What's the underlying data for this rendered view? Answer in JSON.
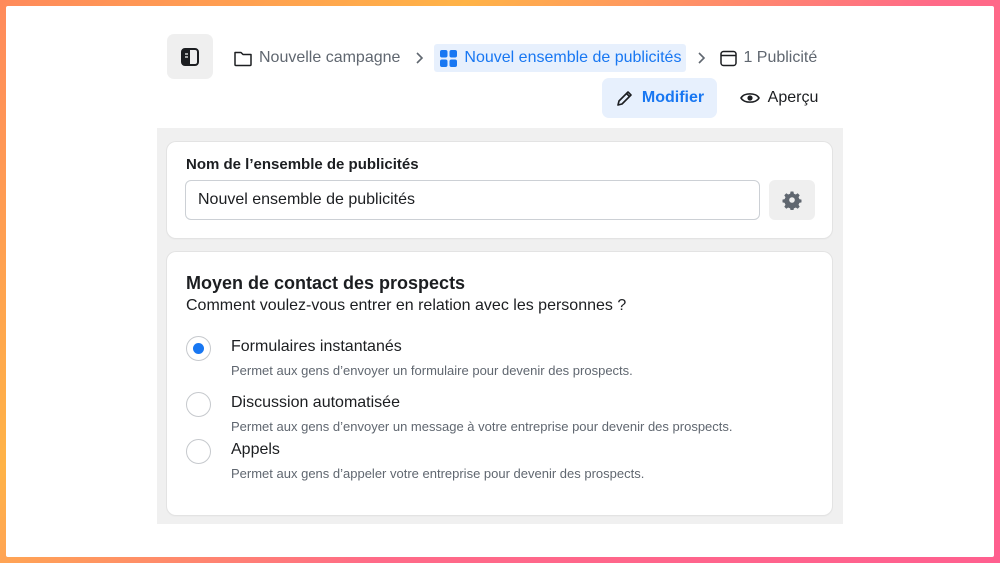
{
  "breadcrumb": {
    "campaign": "Nouvelle campagne",
    "adset": "Nouvel ensemble de publicités",
    "ad": "1 Publicité"
  },
  "toolbar": {
    "edit_label": "Modifier",
    "preview_label": "Aperçu"
  },
  "adset_name": {
    "label": "Nom de l’ensemble de publicités",
    "value": "Nouvel ensemble de publicités"
  },
  "contact_method": {
    "title": "Moyen de contact des prospects",
    "subtitle": "Comment voulez-vous entrer en relation avec les personnes ?",
    "options": [
      {
        "label": "Formulaires instantanés",
        "description": "Permet aux gens d’envoyer un formulaire pour devenir des prospects.",
        "selected": true
      },
      {
        "label": "Discussion automatisée",
        "description": "Permet aux gens d’envoyer un message à votre entreprise pour devenir des prospects.",
        "selected": false
      },
      {
        "label": "Appels",
        "description": "Permet aux gens d’appeler votre entreprise pour devenir des prospects.",
        "selected": false
      }
    ]
  },
  "colors": {
    "accent": "#1877f2",
    "accent_bg": "#e7f0fd",
    "panel_bg": "#f0f0f0"
  },
  "icons": [
    "sidebar-toggle-icon",
    "folder-icon",
    "grid-icon",
    "chevron-right-icon",
    "window-icon",
    "pencil-icon",
    "eye-icon",
    "gear-icon"
  ]
}
